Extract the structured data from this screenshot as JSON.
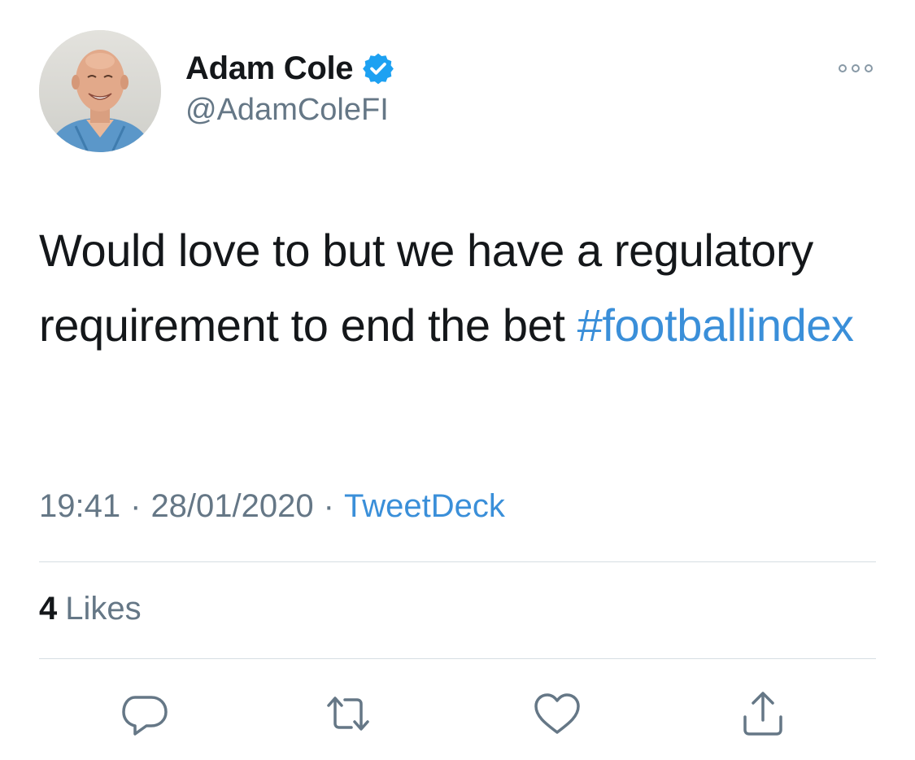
{
  "tweet": {
    "author": {
      "display_name": "Adam Cole",
      "handle": "@AdamColeFI",
      "verified": true,
      "avatar": "avatar-photo-smiling-man"
    },
    "text_parts": {
      "body": "Would love to but we have a regulatory requirement to end the bet",
      "hashtag": "#footballindex"
    },
    "meta": {
      "time": "19:41",
      "separator": "·",
      "date": "28/01/2020",
      "source": "TweetDeck"
    },
    "engagement": {
      "likes_count": "4",
      "likes_label": "Likes"
    },
    "actions": [
      {
        "icon": "reply-icon"
      },
      {
        "icon": "retweet-icon"
      },
      {
        "icon": "like-icon"
      },
      {
        "icon": "share-icon"
      }
    ],
    "menu_icon": "more-options-icon"
  },
  "colors": {
    "accent": "#3a8fd9",
    "verified_badge": "#1da1f2",
    "text_primary": "#14171a",
    "text_secondary": "#657786",
    "divider": "#d6dde3"
  }
}
